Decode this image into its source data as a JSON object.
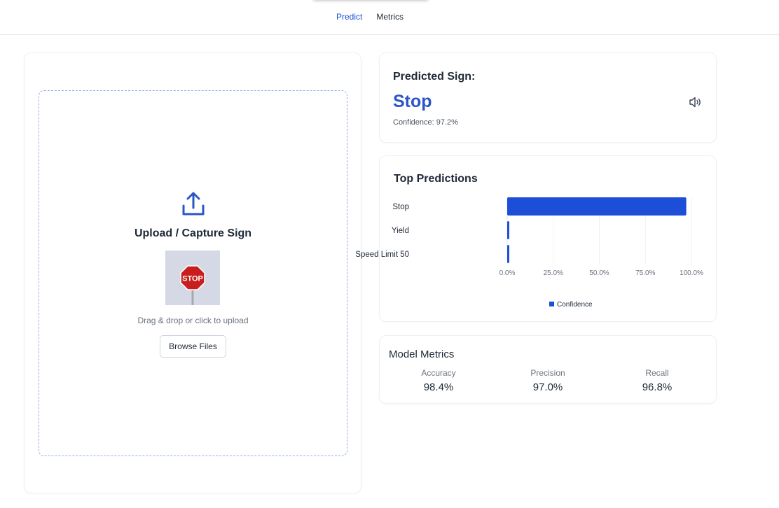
{
  "nav": {
    "tabs": [
      {
        "label": "Predict"
      },
      {
        "label": "Metrics"
      }
    ]
  },
  "upload": {
    "title": "Upload / Capture Sign",
    "drag_text": "Drag & drop or click to upload",
    "browse_label": "Browse Files",
    "preview_sign_text": "STOP"
  },
  "prediction": {
    "heading": "Predicted Sign:",
    "sign": "Stop",
    "confidence_text": "Confidence: 97.2%"
  },
  "top_predictions": {
    "heading": "Top Predictions"
  },
  "chart_data": {
    "type": "bar",
    "orientation": "horizontal",
    "categories": [
      "Stop",
      "Yield",
      "Speed Limit 50"
    ],
    "series": [
      {
        "name": "Confidence",
        "values": [
          97.2,
          1.0,
          0.8
        ],
        "color": "#1d4ed8"
      }
    ],
    "xlim": [
      0,
      100
    ],
    "xticks": [
      "0.0%",
      "25.0%",
      "50.0%",
      "75.0%",
      "100.0%"
    ],
    "grid": true,
    "legend": "bottom"
  },
  "metrics": {
    "heading": "Model Metrics",
    "items": [
      {
        "label": "Accuracy",
        "value": "98.4%"
      },
      {
        "label": "Precision",
        "value": "97.0%"
      },
      {
        "label": "Recall",
        "value": "96.8%"
      }
    ]
  },
  "colors": {
    "accent": "#2a56c6",
    "bar": "#1d4ed8",
    "stop_red": "#c81e1e"
  }
}
